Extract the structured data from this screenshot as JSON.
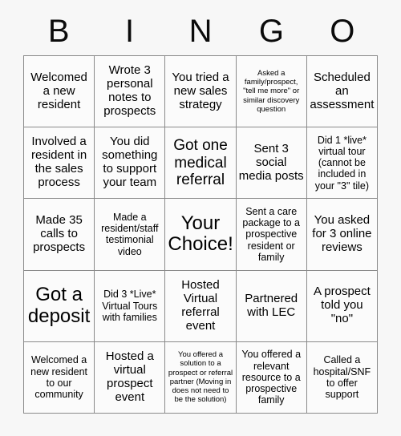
{
  "header": {
    "letters": [
      "B",
      "I",
      "N",
      "G",
      "O"
    ]
  },
  "grid": {
    "rows": 5,
    "columns": 5,
    "cells": [
      {
        "text": "Welcomed a new resident",
        "size": "md"
      },
      {
        "text": "Wrote 3 personal notes to prospects",
        "size": "md"
      },
      {
        "text": "You tried a new sales strategy",
        "size": "md"
      },
      {
        "text": "Asked a family/prospect, \"tell me more\" or similar discovery question",
        "size": "xs"
      },
      {
        "text": "Scheduled an assessment",
        "size": "md"
      },
      {
        "text": "Involved a resident in the sales process",
        "size": "md"
      },
      {
        "text": "You did something to support your team",
        "size": "md"
      },
      {
        "text": "Got one medical referral",
        "size": "lg"
      },
      {
        "text": "Sent 3 social media posts",
        "size": "md"
      },
      {
        "text": "Did 1 *live* virtual tour (cannot be included in your \"3\" tile)",
        "size": "sm"
      },
      {
        "text": "Made 35 calls to prospects",
        "size": "md"
      },
      {
        "text": "Made a resident/staff testimonial video",
        "size": "sm"
      },
      {
        "text": "Your Choice!",
        "size": "xl"
      },
      {
        "text": "Sent a care package to a prospective resident or family",
        "size": "sm"
      },
      {
        "text": "You asked for 3 online reviews",
        "size": "md"
      },
      {
        "text": "Got a deposit",
        "size": "xl"
      },
      {
        "text": "Did 3 *Live* Virtual Tours with families",
        "size": "sm"
      },
      {
        "text": "Hosted Virtual referral event",
        "size": "md"
      },
      {
        "text": "Partnered with LEC",
        "size": "md"
      },
      {
        "text": "A prospect told you \"no\"",
        "size": "md"
      },
      {
        "text": "Welcomed a new resident to our community",
        "size": "sm"
      },
      {
        "text": "Hosted a virtual prospect event",
        "size": "md"
      },
      {
        "text": "You offered a solution to a prospect or referral partner (Moving in does not need to be the solution)",
        "size": "xs"
      },
      {
        "text": "You offered a relevant resource to a prospective family",
        "size": "sm"
      },
      {
        "text": "Called a hospital/SNF to offer support",
        "size": "sm"
      }
    ]
  },
  "colors": {
    "page_background": "#f7f7f7",
    "cell_background": "#fbfbfb",
    "border": "#8a8a8a",
    "text": "#000000"
  }
}
